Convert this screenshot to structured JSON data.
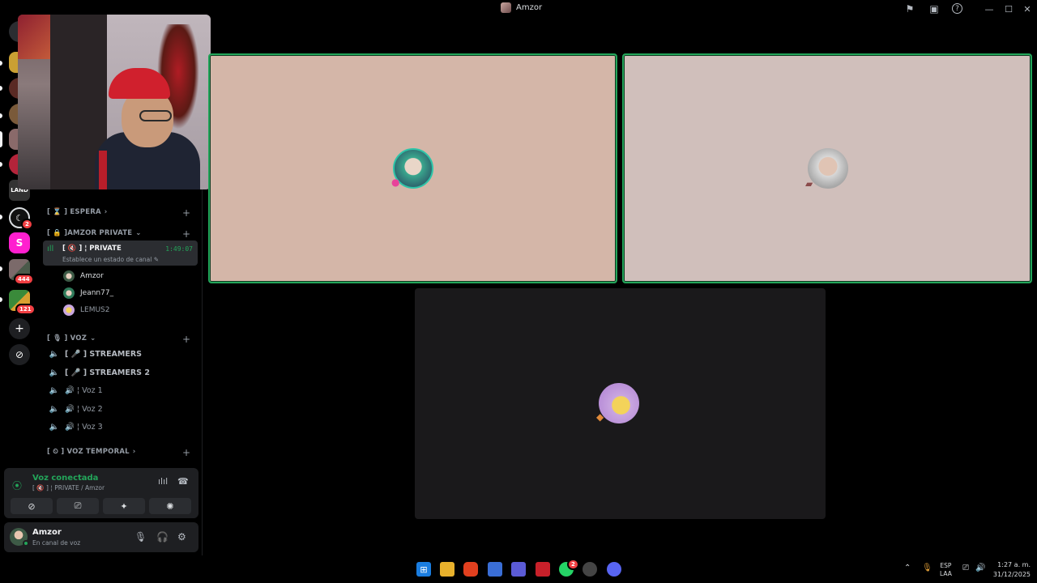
{
  "window": {
    "title": "Amzor",
    "titlebar_icons": [
      "inbox-flag-icon",
      "window-icon",
      "help-icon"
    ],
    "controls": [
      "—",
      "☐",
      "✕"
    ]
  },
  "rail": {
    "badges": {
      "server_2": "2",
      "server_444": "444",
      "server_121": "121"
    },
    "server_s_label": "S",
    "land_label": "LAND",
    "add_label": "+",
    "explore_label": "⊘"
  },
  "sidebar": {
    "categories": {
      "espera": "[ ⌛ ] ESPERA",
      "amzor_private": "[ 🔒 ]AMZOR PRIVATE",
      "voz": "[ 🎙 ] VOZ",
      "voz_temporal": "[ ⏲ ] VOZ TEMPORAL"
    },
    "active_channel": {
      "name": "[ 🔇 ] ¦ PRIVATE",
      "status": "Establece un estado de canal ✎",
      "timer": "1:49:07"
    },
    "members": [
      "Amzor",
      "Jeann77_",
      "LEMUS2"
    ],
    "voice_channels": [
      "[ 🎤 ] STREAMERS",
      "[ 🎤 ] STREAMERS 2",
      "🔊 ¦ Voz 1",
      "🔊 ¦ Voz 2",
      "🔊 ¦ Voz 3"
    ]
  },
  "voice_panel": {
    "title": "Voz conectada",
    "subtitle": "[ 🔇 ] ¦ PRIVATE / Amzor"
  },
  "user_panel": {
    "name": "Amzor",
    "status": "En canal de voz"
  },
  "taskbar": {
    "lang_1": "ESP",
    "lang_2": "LAA",
    "time": "1:27 a. m.",
    "date": "31/12/2025",
    "whatsapp_badge": "2"
  },
  "colors": {
    "speaking": "#23a55a",
    "tile1_bg": "#d4b6a8",
    "tile2_bg": "#d0bfbb",
    "tile3_bg": "#1a191b",
    "brand_pink": "#ff1fcf"
  }
}
